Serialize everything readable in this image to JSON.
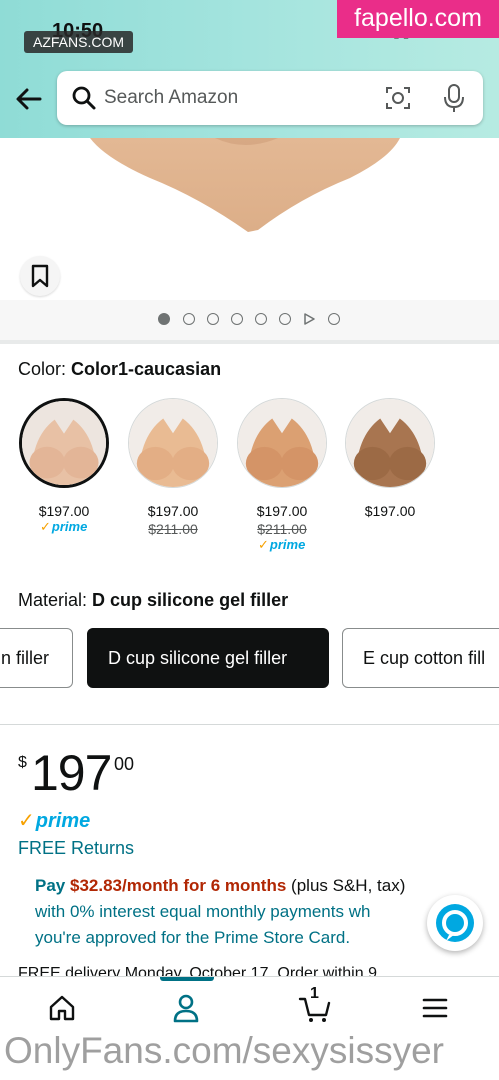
{
  "status_bar": {
    "time": "10:50",
    "indicators": "▮▮ ▾ ▬"
  },
  "watermarks": {
    "azfans": "AZFANS.COM",
    "fapello": "fapello.com",
    "onlyfans": "OnlyFans.com/sexysissyer"
  },
  "search": {
    "placeholder": "Search Amazon"
  },
  "color": {
    "label": "Color:",
    "selected": "Color1-caucasian",
    "options": [
      {
        "price": "$197.00",
        "list_price": "",
        "prime": "prime",
        "tone": "#e9c0a2"
      },
      {
        "price": "$197.00",
        "list_price": "$211.00",
        "prime": "",
        "tone": "#e8b890"
      },
      {
        "price": "$197.00",
        "list_price": "$211.00",
        "prime": "prime",
        "tone": "#d99e73"
      },
      {
        "price": "$197.00",
        "list_price": "",
        "prime": "",
        "tone": "#a5714b"
      }
    ]
  },
  "material": {
    "label": "Material:",
    "selected": "D cup silicone gel filler",
    "options": [
      "n filler",
      "D cup silicone gel filler",
      "E cup cotton fill"
    ]
  },
  "price": {
    "symbol": "$",
    "whole": "197",
    "fraction": "00"
  },
  "prime_label": "prime",
  "free_returns": "FREE Returns",
  "financing": {
    "pay": "Pay",
    "amount": "$32.83/month for 6 months",
    "suffix": "(plus S&H, tax)",
    "line2": "with 0% interest equal monthly payments wh",
    "line3": "you're approved for the Prime Store Card."
  },
  "delivery_text": "FREE delivery Monday, October 17. Order within 9",
  "colors": {
    "accent": "#007185",
    "prime_blue": "#00a8e1",
    "deal_red": "#b12704",
    "header_teal": "#a4e4de"
  }
}
